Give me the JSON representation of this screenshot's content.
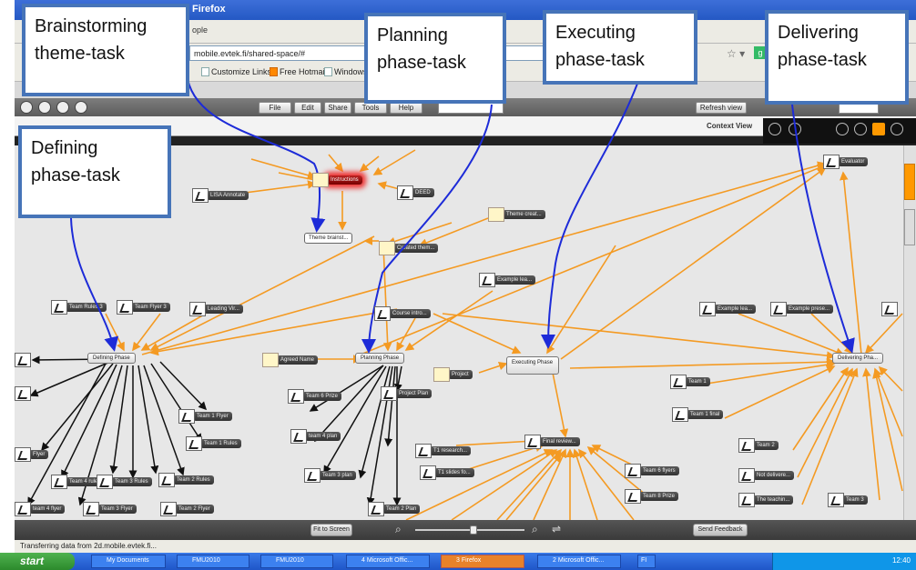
{
  "browser": {
    "title": "Firefox",
    "menu_text": "ople",
    "url": "mobile.evtek.fi/shared-space/#",
    "bookmarks": [
      "Customize Links",
      "Free Hotmail",
      "Windows"
    ]
  },
  "toolbar": {
    "buttons": [
      "File",
      "Edit",
      "Share",
      "Tools",
      "Help"
    ],
    "refresh_label": "Refresh view"
  },
  "view": {
    "label": "Context View"
  },
  "nodes": [
    {
      "id": "instructions",
      "label": "Instructions"
    },
    {
      "id": "lisa",
      "label": "LISA Annotate"
    },
    {
      "id": "deed",
      "label": "DEED"
    },
    {
      "id": "themecreat",
      "label": "Theme creat..."
    },
    {
      "id": "themebrainst",
      "label": "Theme brainst..."
    },
    {
      "id": "createtheme",
      "label": "Created them..."
    },
    {
      "id": "evaluator",
      "label": "Evaluator"
    },
    {
      "id": "examplelea",
      "label": "Example lea..."
    },
    {
      "id": "courseintro",
      "label": "Course intro..."
    },
    {
      "id": "teamrules3",
      "label": "Team Rules 3"
    },
    {
      "id": "teamflyer3",
      "label": "Team Flyer 3"
    },
    {
      "id": "leadingvir",
      "label": "Leading Vir..."
    },
    {
      "id": "examplelea2",
      "label": "Example lea..."
    },
    {
      "id": "examplepres",
      "label": "Example prese..."
    },
    {
      "id": "definingphase",
      "label": "Defining Phase"
    },
    {
      "id": "agreedname",
      "label": "Agreed Name"
    },
    {
      "id": "planningphase",
      "label": "Planning Phase"
    },
    {
      "id": "executingphase",
      "label": "Executing Phase"
    },
    {
      "id": "project",
      "label": "Project"
    },
    {
      "id": "deliveringphase",
      "label": "Delivering Pha..."
    },
    {
      "id": "teamflyer",
      "label": "Team Flyer"
    },
    {
      "id": "team6pres",
      "label": "Team 6 Prize"
    },
    {
      "id": "projectplan",
      "label": "Project Plan"
    },
    {
      "id": "team1",
      "label": "Team 1"
    },
    {
      "id": "team1fin",
      "label": "Team 1 final"
    },
    {
      "id": "team1flyer",
      "label": "Team 1 Flyer"
    },
    {
      "id": "team1rules",
      "label": "Team 1 Rules"
    },
    {
      "id": "team4plan",
      "label": "team 4 plan"
    },
    {
      "id": "finalreview",
      "label": "Final review..."
    },
    {
      "id": "t1research",
      "label": "T1 research..."
    },
    {
      "id": "t1slides",
      "label": "T1 slides fo..."
    },
    {
      "id": "team6flyers",
      "label": "Team 6 flyers"
    },
    {
      "id": "team2",
      "label": "Team 2"
    },
    {
      "id": "notdeliver",
      "label": "Not delivere..."
    },
    {
      "id": "theteachin",
      "label": "The teachin..."
    },
    {
      "id": "team4rules",
      "label": "Team 4 rules"
    },
    {
      "id": "team3rules",
      "label": "Team 3 Rules"
    },
    {
      "id": "team2rules",
      "label": "Team 2 Rules"
    },
    {
      "id": "team3plan",
      "label": "Team 3 plan"
    },
    {
      "id": "team8prize",
      "label": "Team 8 Prize"
    },
    {
      "id": "team4flyer",
      "label": "team 4 flyer"
    },
    {
      "id": "team3flyer",
      "label": "Team 3 Flyer"
    },
    {
      "id": "team2flyer",
      "label": "Team 2 Flyer"
    },
    {
      "id": "team2plan",
      "label": "Team 2 Plan"
    },
    {
      "id": "team3",
      "label": "Team 3"
    },
    {
      "id": "flyer",
      "label": "Flyer"
    }
  ],
  "zoom": {
    "fit_label": "Fit to Screen",
    "feedback_label": "Send Feedback"
  },
  "status": "Transferring data from 2d.mobile.evtek.fi...",
  "taskbar": {
    "start": "start",
    "tasks": [
      "My Documents",
      "FMU2010",
      "FMU2010",
      "4 Microsoft Offic...",
      "3 Firefox",
      "2 Microsoft Offic..."
    ],
    "tray_label": "FI",
    "clock": "12:40"
  },
  "callouts": {
    "brainstorming": [
      "Brainstorming",
      "theme-task"
    ],
    "planning": [
      "Planning",
      "phase-task"
    ],
    "executing": [
      "Executing",
      "phase-task"
    ],
    "delivering": [
      "Delivering",
      "phase-task"
    ],
    "defining": [
      "Defining",
      "phase-task"
    ]
  }
}
